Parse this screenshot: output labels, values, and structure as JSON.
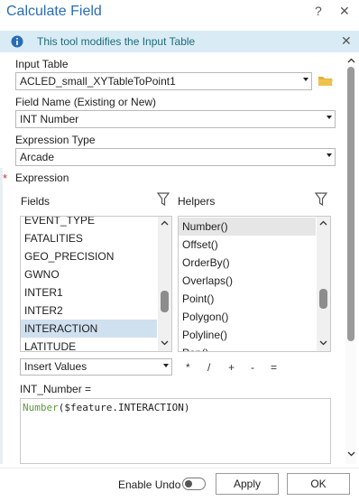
{
  "window": {
    "title": "Calculate Field",
    "help_glyph": "?",
    "close_glyph": "✕"
  },
  "banner": {
    "message": "This tool modifies the Input Table",
    "close_glyph": "✕"
  },
  "form": {
    "input_table_label": "Input Table",
    "input_table_value": "ACLED_small_XYTableToPoint1",
    "field_name_label": "Field Name (Existing or New)",
    "field_name_value": "INT Number",
    "expression_type_label": "Expression Type",
    "expression_type_value": "Arcade",
    "expression_required_mark": "*",
    "expression_label": "Expression",
    "fields_header": "Fields",
    "helpers_header": "Helpers",
    "fields": [
      "EVENT_TYPE",
      "FATALITIES",
      "GEO_PRECISION",
      "GWNO",
      "INTER1",
      "INTER2",
      "INTERACTION",
      "LATITUDE"
    ],
    "selected_field": "INTERACTION",
    "helpers": [
      "Number()",
      "Offset()",
      "OrderBy()",
      "Overlaps()",
      "Point()",
      "Polygon()",
      "Polyline()",
      "Pop()"
    ],
    "highlighted_helper": "Number()",
    "insert_values_label": "Insert Values",
    "operators": [
      "*",
      "/",
      "+",
      "-",
      "="
    ],
    "expression_target": "INT_Number =",
    "expression_fn": "Number",
    "expression_arg": "($feature.INTERACTION)"
  },
  "footer": {
    "enable_undo_label": "Enable Undo",
    "apply_label": "Apply",
    "ok_label": "OK"
  },
  "colors": {
    "title": "#2a6cb3",
    "banner_bg": "#d9ecf5",
    "selection": "#cfe0ef",
    "code_fn": "#5a9a3a"
  }
}
